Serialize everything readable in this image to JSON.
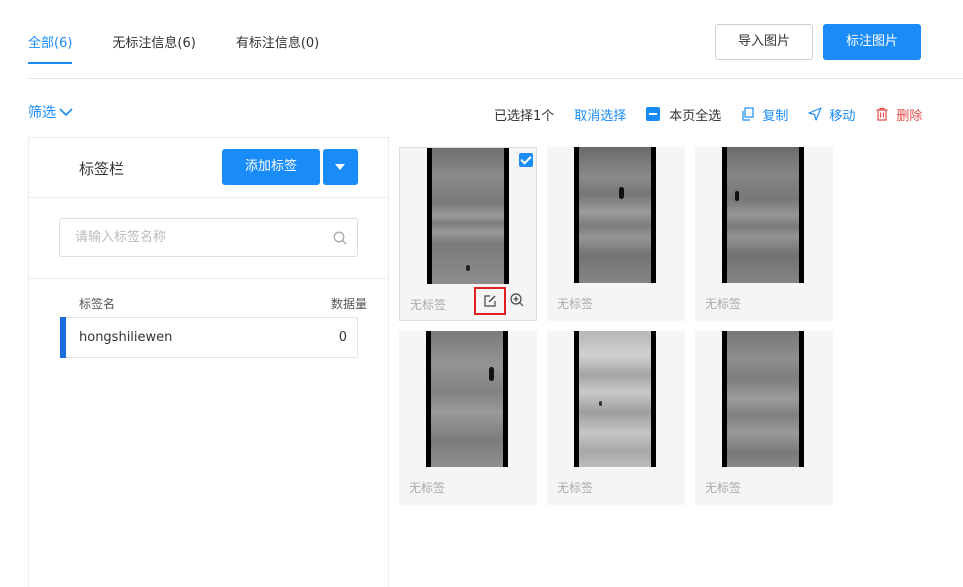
{
  "tabs": [
    {
      "label": "全部(6)"
    },
    {
      "label": "无标注信息(6)"
    },
    {
      "label": "有标注信息(0)"
    }
  ],
  "buttons": {
    "import": "导入图片",
    "annotate": "标注图片"
  },
  "filter": {
    "label": "筛选"
  },
  "toolbar": {
    "selected": "已选择1个",
    "cancel": "取消选择",
    "page_select_all": "本页全选",
    "copy": "复制",
    "move": "移动",
    "delete": "删除"
  },
  "label_panel": {
    "title": "标签栏",
    "add_label": "添加标签",
    "search_placeholder": "请输入标签名称",
    "col_name": "标签名",
    "col_count": "数据量",
    "labels": [
      {
        "name": "hongshiliewen",
        "count": "0"
      }
    ]
  },
  "images": [
    {
      "label": "无标签",
      "selected": true
    },
    {
      "label": "无标签",
      "selected": false
    },
    {
      "label": "无标签",
      "selected": false
    },
    {
      "label": "无标签",
      "selected": false
    },
    {
      "label": "无标签",
      "selected": false
    },
    {
      "label": "无标签",
      "selected": false
    }
  ],
  "colors": {
    "accent": "#1a8cf7",
    "danger": "#e84a4a",
    "highlight": "#e02020"
  }
}
